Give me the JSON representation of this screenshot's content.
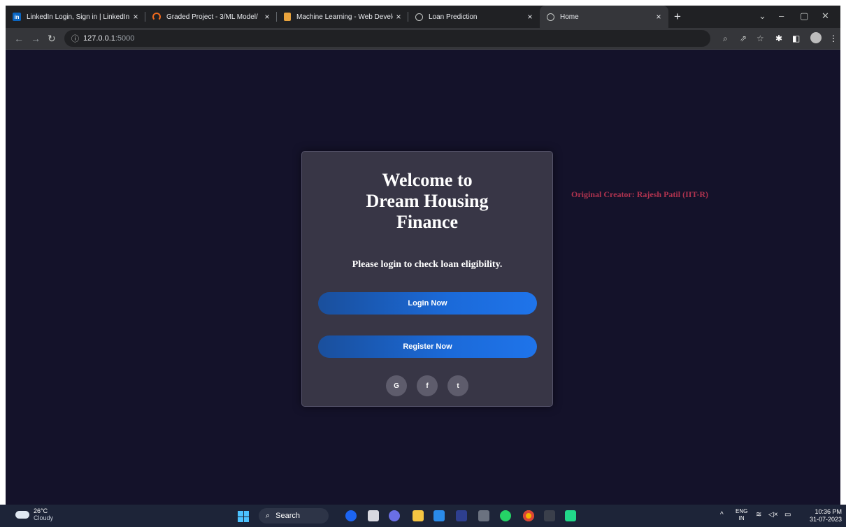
{
  "browser": {
    "tabs": [
      {
        "title": "LinkedIn Login, Sign in | LinkedIn",
        "icon": "linkedin-icon",
        "fav_text": "in",
        "color": "#0a66c2",
        "active": false
      },
      {
        "title": "Graded Project - 3/ML Model/",
        "icon": "arc-icon",
        "fav_text": "",
        "color": "#f26b1d",
        "active": false
      },
      {
        "title": "Machine Learning - Web Develop",
        "icon": "book-icon",
        "fav_text": "",
        "color": "#e8a33d",
        "active": false
      },
      {
        "title": "Loan Prediction",
        "icon": "globe-icon",
        "fav_text": "",
        "color": "#9aa0a6",
        "active": false
      },
      {
        "title": "Home",
        "icon": "globe-icon",
        "fav_text": "",
        "color": "#9aa0a6",
        "active": true
      }
    ],
    "close_glyph": "×",
    "new_tab_glyph": "+",
    "url_host": "127.0.0.1",
    "url_port": ":5000",
    "icons": {
      "back": "arrow-left-icon",
      "forward": "arrow-right-icon",
      "reload": "reload-icon",
      "info": "info-icon",
      "zoom": "zoom-icon",
      "share": "share-icon",
      "bookmark": "star-icon",
      "extensions": "puzzle-icon",
      "sidepanel": "side-panel-icon",
      "profile": "profile-icon",
      "menu": "kebab-menu-icon"
    }
  },
  "page": {
    "title_lines": [
      "Welcome to",
      "Dream Housing",
      "Finance"
    ],
    "subtitle": "Please login to check loan eligibility.",
    "login_label": "Login Now",
    "register_label": "Register Now",
    "social": [
      {
        "name": "google",
        "glyph": "G"
      },
      {
        "name": "facebook",
        "glyph": "f"
      },
      {
        "name": "twitter",
        "glyph": "t"
      }
    ],
    "creator_text": "Original Creator: Rajesh Patil (IIT-R)",
    "colors": {
      "background": "#14122a",
      "card": "#383646",
      "button": "#1b6ad9",
      "creator": "#b0334f"
    }
  },
  "taskbar": {
    "weather_temp": "26°C",
    "weather_cond": "Cloudy",
    "search_label": "Search",
    "lang_top": "ENG",
    "lang_bottom": "IN",
    "time": "10:36 PM",
    "date": "31-07-2023",
    "apps": [
      "bing-icon",
      "file-icon",
      "meet-icon",
      "folder-icon",
      "vscode-icon",
      "photos-icon",
      "mail-icon",
      "whatsapp-icon",
      "chrome-icon",
      "terminal-icon",
      "pycharm-icon"
    ]
  }
}
